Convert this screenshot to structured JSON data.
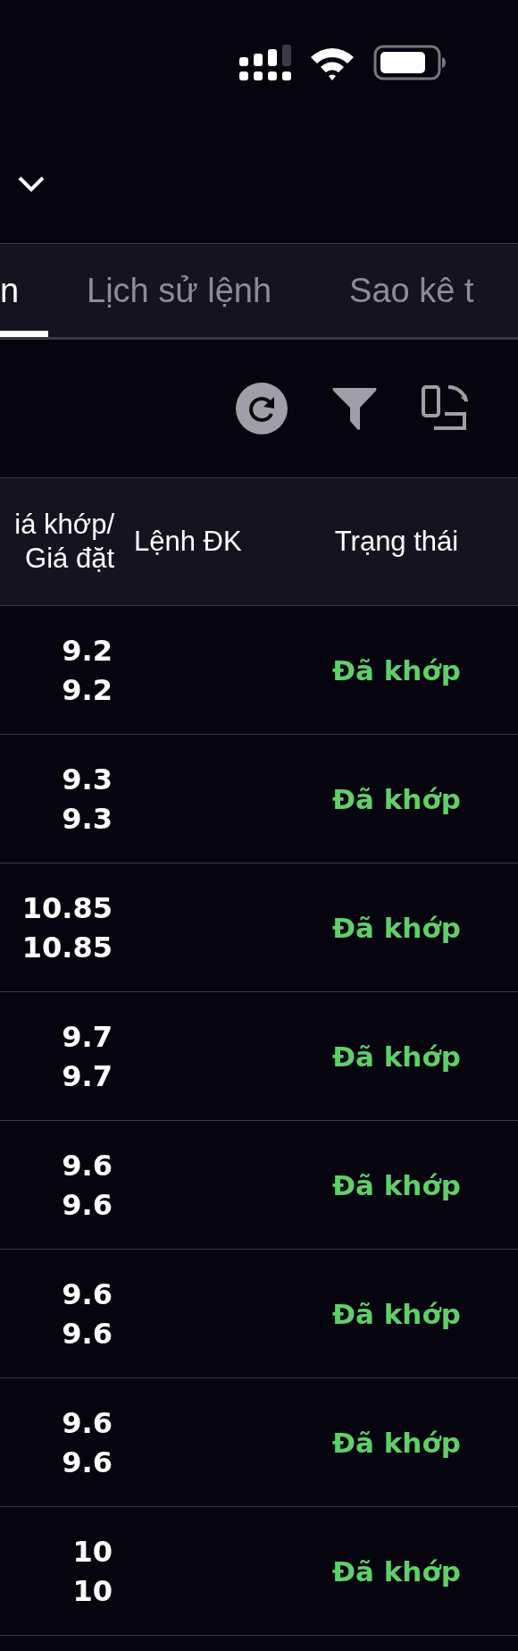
{
  "tabs": [
    {
      "label": "n",
      "selected": true
    },
    {
      "label": "Lịch sử lệnh",
      "selected": false
    },
    {
      "label": "Sao kê t",
      "selected": false
    }
  ],
  "table": {
    "columns": [
      "iá khớp/\nGiá đặt",
      "Lệnh ĐK",
      "Trạng thái"
    ],
    "rows": [
      {
        "match_price": "9.2",
        "order_price": "9.2",
        "status": "Đã khớp"
      },
      {
        "match_price": "9.3",
        "order_price": "9.3",
        "status": "Đã khớp"
      },
      {
        "match_price": "10.85",
        "order_price": "10.85",
        "status": "Đã khớp"
      },
      {
        "match_price": "9.7",
        "order_price": "9.7",
        "status": "Đã khớp"
      },
      {
        "match_price": "9.6",
        "order_price": "9.6",
        "status": "Đã khớp"
      },
      {
        "match_price": "9.6",
        "order_price": "9.6",
        "status": "Đã khớp"
      },
      {
        "match_price": "9.6",
        "order_price": "9.6",
        "status": "Đã khớp"
      },
      {
        "match_price": "10",
        "order_price": "10",
        "status": "Đã khớp"
      }
    ]
  }
}
